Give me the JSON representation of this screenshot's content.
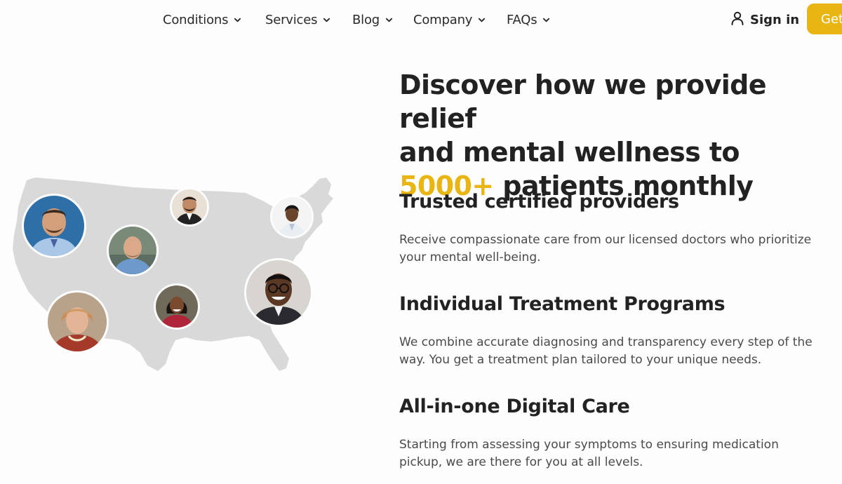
{
  "nav": {
    "items": [
      {
        "label": "Conditions"
      },
      {
        "label": "Services"
      },
      {
        "label": "Blog"
      },
      {
        "label": "Company"
      },
      {
        "label": "FAQs"
      }
    ],
    "sign_in_label": "Sign in",
    "cta_label": "Get",
    "accent_color": "#e8b513"
  },
  "hero": {
    "headline_line1": "Discover how we provide relief",
    "headline_line2": "and mental wellness to",
    "headline_highlight": "5000+",
    "headline_rest": "patients monthly"
  },
  "features": [
    {
      "title": "Trusted certified providers",
      "text": "Receive compassionate care from our licensed doctors who prioritize your mental well-being."
    },
    {
      "title": "Individual Treatment Programs",
      "text": "We combine accurate diagnosing and transparency every step of the way. You get a treatment plan tailored to your unique needs."
    },
    {
      "title": "All-in-one Digital Care",
      "text": "Starting from assessing your symptoms to ensuring medication pickup, we are there for you at all levels."
    }
  ],
  "map": {
    "icon": "us-map-illustration",
    "providers": [
      {
        "icon": "provider-photo-man-blue-shirt"
      },
      {
        "icon": "provider-photo-man-suit"
      },
      {
        "icon": "provider-photo-woman-white-coat"
      },
      {
        "icon": "provider-photo-man-bald"
      },
      {
        "icon": "provider-photo-man-glasses"
      },
      {
        "icon": "provider-photo-woman-older"
      },
      {
        "icon": "provider-photo-woman-young"
      }
    ]
  }
}
